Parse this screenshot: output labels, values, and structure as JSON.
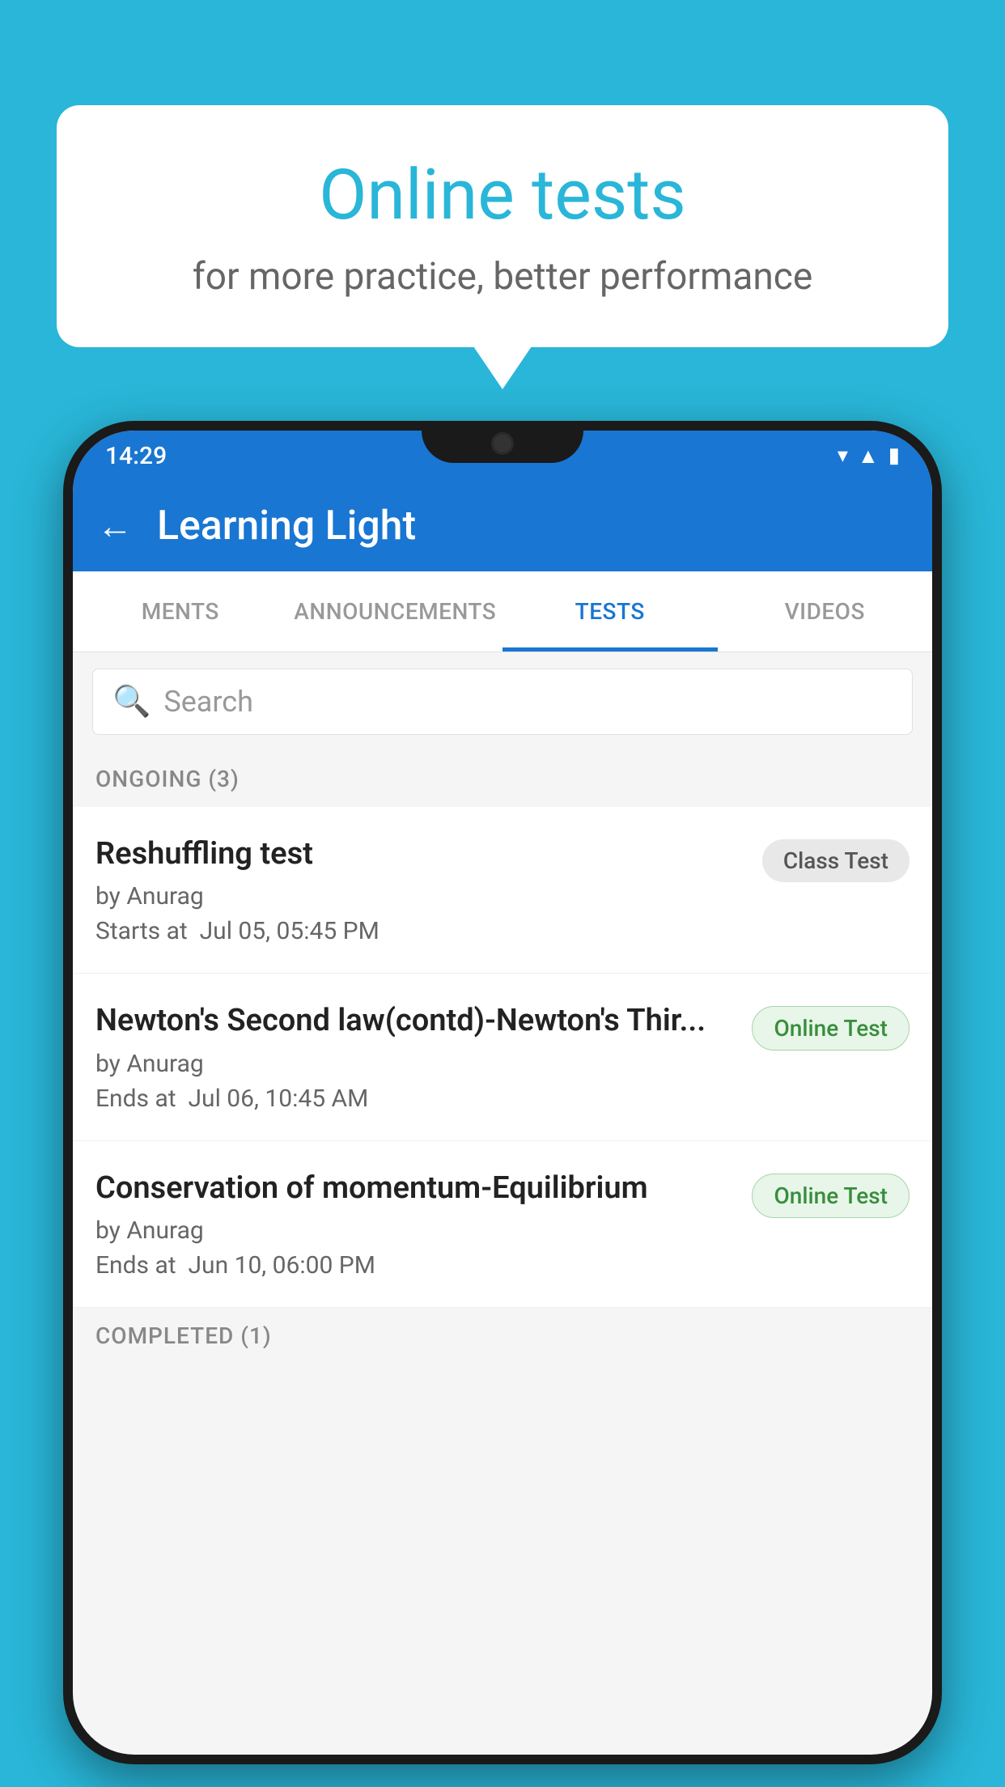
{
  "background_color": "#29b6d8",
  "speech_bubble": {
    "title": "Online tests",
    "subtitle": "for more practice, better performance"
  },
  "phone": {
    "status_bar": {
      "time": "14:29",
      "icons": [
        "wifi",
        "signal",
        "battery"
      ]
    },
    "app_bar": {
      "back_label": "←",
      "title": "Learning Light"
    },
    "tabs": [
      {
        "label": "MENTS",
        "active": false
      },
      {
        "label": "ANNOUNCEMENTS",
        "active": false
      },
      {
        "label": "TESTS",
        "active": true
      },
      {
        "label": "VIDEOS",
        "active": false
      }
    ],
    "search": {
      "placeholder": "Search",
      "icon": "🔍"
    },
    "ongoing_section": {
      "header": "ONGOING (3)",
      "tests": [
        {
          "name": "Reshuffling test",
          "author": "by Anurag",
          "time_label": "Starts at",
          "time": "Jul 05, 05:45 PM",
          "badge": "Class Test",
          "badge_type": "class"
        },
        {
          "name": "Newton's Second law(contd)-Newton's Thir...",
          "author": "by Anurag",
          "time_label": "Ends at",
          "time": "Jul 06, 10:45 AM",
          "badge": "Online Test",
          "badge_type": "online"
        },
        {
          "name": "Conservation of momentum-Equilibrium",
          "author": "by Anurag",
          "time_label": "Ends at",
          "time": "Jun 10, 06:00 PM",
          "badge": "Online Test",
          "badge_type": "online"
        }
      ]
    },
    "completed_section": {
      "header": "COMPLETED (1)"
    }
  }
}
